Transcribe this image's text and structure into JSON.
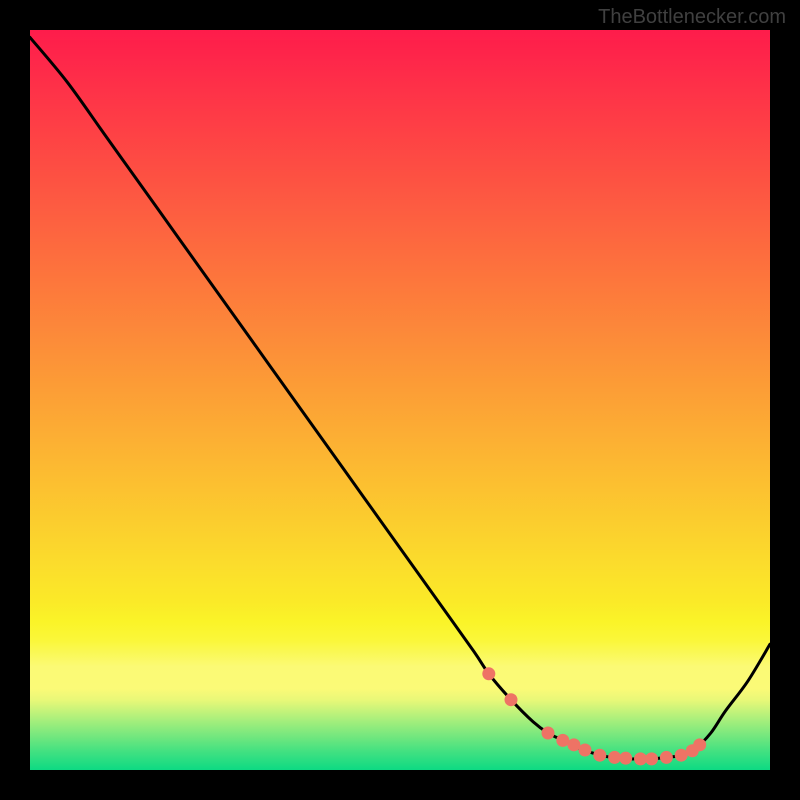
{
  "attribution": "TheBottlenecker.com",
  "chart_data": {
    "type": "line",
    "title": "",
    "xlabel": "",
    "ylabel": "",
    "xlim": [
      0,
      100
    ],
    "ylim": [
      0,
      100
    ],
    "x": [
      0,
      5,
      10,
      15,
      20,
      25,
      30,
      35,
      40,
      45,
      50,
      55,
      60,
      62,
      65,
      68,
      70,
      72,
      74,
      76,
      78,
      80,
      82,
      84,
      86,
      88,
      90,
      92,
      94,
      97,
      100
    ],
    "values": [
      99,
      93,
      86,
      79,
      72,
      65,
      58,
      51,
      44,
      37,
      30,
      23,
      16,
      13,
      9.5,
      6.5,
      5,
      4,
      3,
      2.3,
      1.8,
      1.5,
      1.5,
      1.5,
      1.7,
      2,
      3,
      5,
      8,
      12,
      17
    ],
    "markers": {
      "x": [
        62,
        65,
        70,
        72,
        73.5,
        75,
        77,
        79,
        80.5,
        82.5,
        84,
        86,
        88,
        89.5,
        90.5
      ],
      "y": [
        13,
        9.5,
        5,
        4,
        3.4,
        2.7,
        2.0,
        1.7,
        1.6,
        1.5,
        1.5,
        1.7,
        2.0,
        2.6,
        3.4
      ],
      "color": "#ee7365",
      "r": 6.5
    },
    "gradient_stops": [
      {
        "offset": 0.0,
        "color": "#fe1c4b"
      },
      {
        "offset": 0.06,
        "color": "#fe2c49"
      },
      {
        "offset": 0.12,
        "color": "#fe3c46"
      },
      {
        "offset": 0.18,
        "color": "#fd4c43"
      },
      {
        "offset": 0.24,
        "color": "#fd5c41"
      },
      {
        "offset": 0.3,
        "color": "#fd6c3e"
      },
      {
        "offset": 0.36,
        "color": "#fd7c3b"
      },
      {
        "offset": 0.42,
        "color": "#fc8c39"
      },
      {
        "offset": 0.48,
        "color": "#fc9c36"
      },
      {
        "offset": 0.54,
        "color": "#fcac34"
      },
      {
        "offset": 0.6,
        "color": "#fcbc31"
      },
      {
        "offset": 0.66,
        "color": "#fbcc2e"
      },
      {
        "offset": 0.72,
        "color": "#fbdc2c"
      },
      {
        "offset": 0.77,
        "color": "#fbe928"
      },
      {
        "offset": 0.8,
        "color": "#faf428"
      },
      {
        "offset": 0.825,
        "color": "#faf73a"
      },
      {
        "offset": 0.86,
        "color": "#fbfa75"
      },
      {
        "offset": 0.89,
        "color": "#fbfa77"
      },
      {
        "offset": 0.905,
        "color": "#e9f878"
      },
      {
        "offset": 0.92,
        "color": "#c5f37a"
      },
      {
        "offset": 0.935,
        "color": "#a1ee7c"
      },
      {
        "offset": 0.955,
        "color": "#72e77e"
      },
      {
        "offset": 0.975,
        "color": "#42e181"
      },
      {
        "offset": 1.0,
        "color": "#0dda83"
      }
    ],
    "curve_color": "#000000",
    "curve_width": 3
  }
}
